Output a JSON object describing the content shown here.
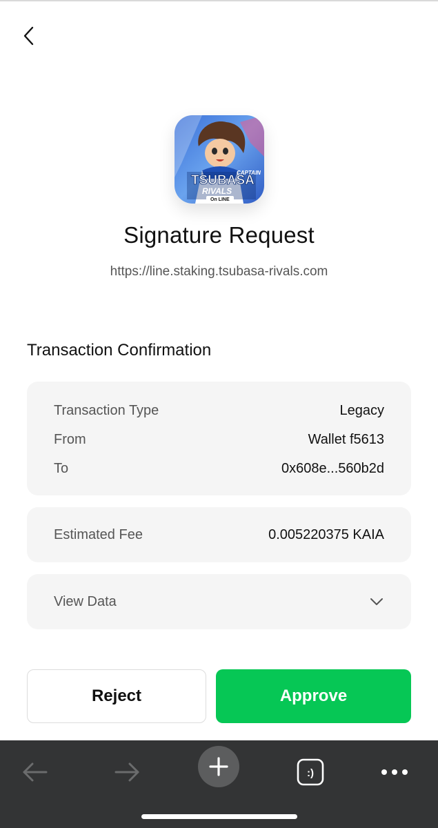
{
  "header": {
    "back_icon": "chevron-left-icon"
  },
  "app": {
    "icon_text_line1": "CAPTAIN",
    "icon_text_line2": "TSUBASA",
    "icon_text_line3": "RIVALS",
    "icon_text_line4": "On LINE"
  },
  "request": {
    "title": "Signature Request",
    "url": "https://line.staking.tsubasa-rivals.com"
  },
  "confirmation": {
    "section_title": "Transaction Confirmation",
    "details": [
      {
        "label": "Transaction Type",
        "value": "Legacy"
      },
      {
        "label": "From",
        "value": "Wallet f5613"
      },
      {
        "label": "To",
        "value": "0x608e...560b2d"
      }
    ],
    "fee": {
      "label": "Estimated Fee",
      "value": "0.005220375 KAIA"
    },
    "view_data": {
      "label": "View Data",
      "icon": "chevron-down-icon"
    }
  },
  "actions": {
    "reject_label": "Reject",
    "approve_label": "Approve",
    "approve_color": "#06c755"
  },
  "browser_bar": {
    "back_icon": "arrow-left-icon",
    "forward_icon": "arrow-right-icon",
    "add_icon": "plus-icon",
    "tab_icon": "smiley-tab-icon",
    "tab_glyph": ":)",
    "more_icon": "more-dots-icon"
  }
}
